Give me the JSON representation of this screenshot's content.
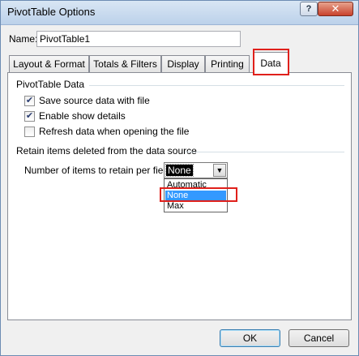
{
  "window": {
    "title": "PivotTable Options",
    "help_glyph": "?",
    "close_glyph": "✕"
  },
  "name": {
    "label": "Name:",
    "value": "PivotTable1"
  },
  "tabs": [
    {
      "label": "Layout & Format",
      "active": false
    },
    {
      "label": "Totals & Filters",
      "active": false
    },
    {
      "label": "Display",
      "active": false
    },
    {
      "label": "Printing",
      "active": false
    },
    {
      "label": "Data",
      "active": true
    }
  ],
  "pivot_data": {
    "title": "PivotTable Data",
    "options": [
      {
        "label": "Save source data with file",
        "checked": true
      },
      {
        "label": "Enable show details",
        "checked": true
      },
      {
        "label": "Refresh data when opening the file",
        "checked": false
      }
    ]
  },
  "retain": {
    "title": "Retain items deleted from the data source",
    "label": "Number of items to retain per field:",
    "selected": "None",
    "options": [
      "Automatic",
      "None",
      "Max"
    ]
  },
  "buttons": {
    "ok": "OK",
    "cancel": "Cancel"
  },
  "colors": {
    "highlight_box": "#e0201b",
    "selection": "#3399ff"
  }
}
